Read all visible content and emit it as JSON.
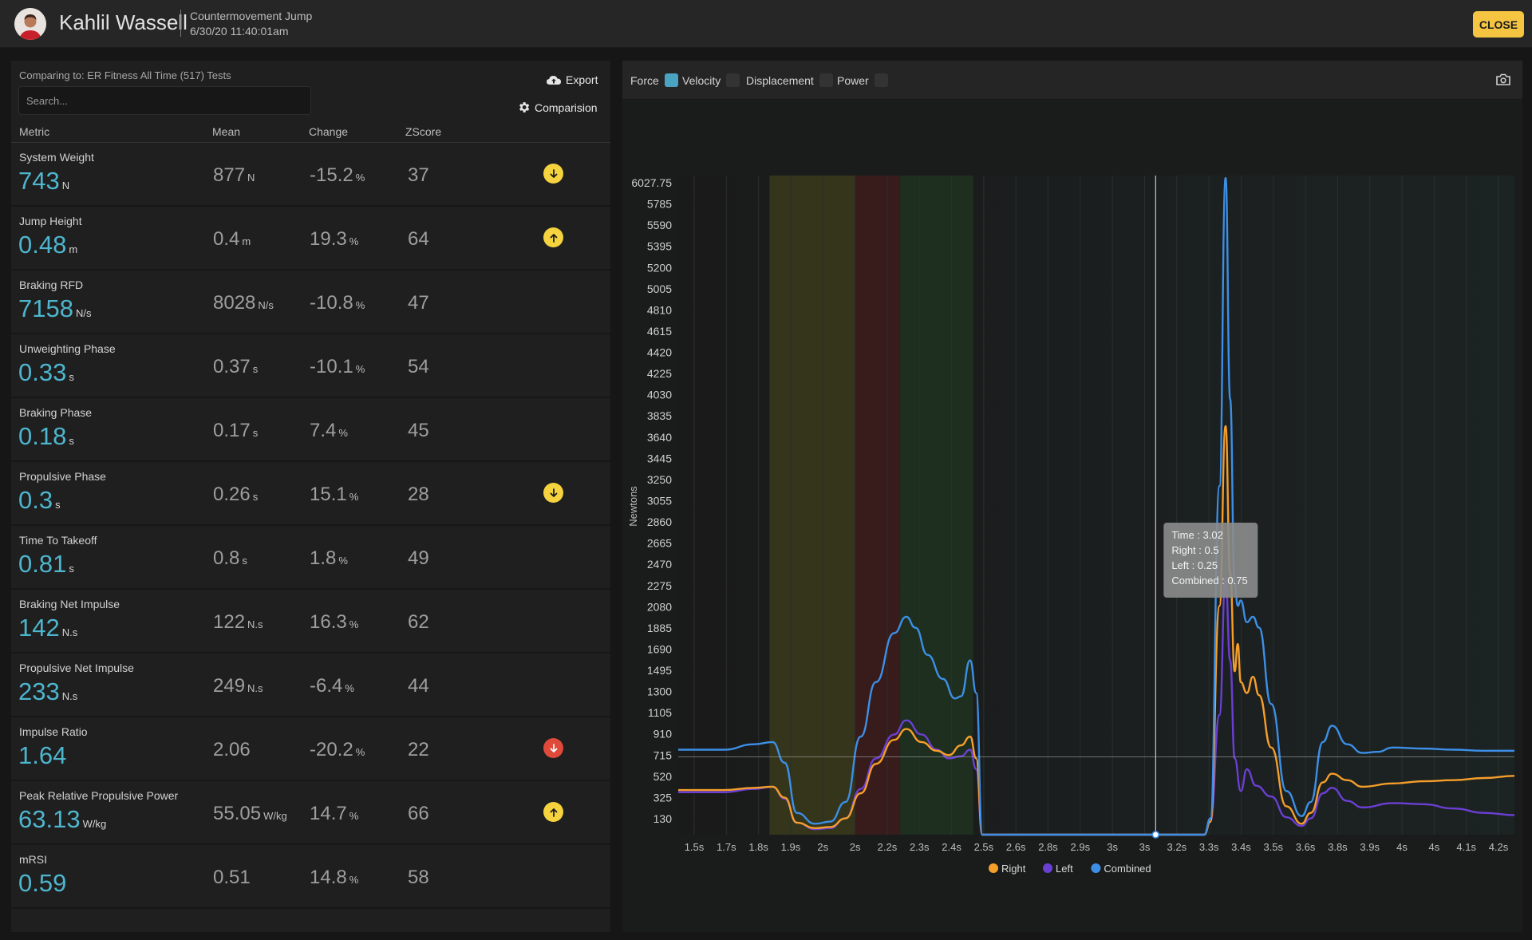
{
  "header": {
    "athlete_name": "Kahlil Wassell",
    "test_name": "Countermovement Jump",
    "test_date": "6/30/20 11:40:01am",
    "close_label": "CLOSE"
  },
  "left": {
    "comparing_text": "Comparing to: ER Fitness All Time (517) Tests",
    "search_placeholder": "Search...",
    "export_label": "Export",
    "comparison_label": "Comparision",
    "columns": [
      "Metric",
      "Mean",
      "Change",
      "ZScore"
    ]
  },
  "metrics": [
    {
      "label": "System Weight",
      "value": "743",
      "unit": "N",
      "mean": "877",
      "mean_unit": "N",
      "change": "-15.2",
      "change_unit": "%",
      "zscore": "37",
      "indicator": "down-yellow"
    },
    {
      "label": "Jump Height",
      "value": "0.48",
      "unit": "m",
      "mean": "0.4",
      "mean_unit": "m",
      "change": "19.3",
      "change_unit": "%",
      "zscore": "64",
      "indicator": "up-yellow"
    },
    {
      "label": "Braking RFD",
      "value": "7158",
      "unit": "N/s",
      "mean": "8028",
      "mean_unit": "N/s",
      "change": "-10.8",
      "change_unit": "%",
      "zscore": "47",
      "indicator": "none"
    },
    {
      "label": "Unweighting Phase",
      "value": "0.33",
      "unit": "s",
      "mean": "0.37",
      "mean_unit": "s",
      "change": "-10.1",
      "change_unit": "%",
      "zscore": "54",
      "indicator": "none"
    },
    {
      "label": "Braking Phase",
      "value": "0.18",
      "unit": "s",
      "mean": "0.17",
      "mean_unit": "s",
      "change": "7.4",
      "change_unit": "%",
      "zscore": "45",
      "indicator": "none"
    },
    {
      "label": "Propulsive Phase",
      "value": "0.3",
      "unit": "s",
      "mean": "0.26",
      "mean_unit": "s",
      "change": "15.1",
      "change_unit": "%",
      "zscore": "28",
      "indicator": "down-yellow"
    },
    {
      "label": "Time To Takeoff",
      "value": "0.81",
      "unit": "s",
      "mean": "0.8",
      "mean_unit": "s",
      "change": "1.8",
      "change_unit": "%",
      "zscore": "49",
      "indicator": "none"
    },
    {
      "label": "Braking Net Impulse",
      "value": "142",
      "unit": "N.s",
      "mean": "122",
      "mean_unit": "N.s",
      "change": "16.3",
      "change_unit": "%",
      "zscore": "62",
      "indicator": "none"
    },
    {
      "label": "Propulsive Net Impulse",
      "value": "233",
      "unit": "N.s",
      "mean": "249",
      "mean_unit": "N.s",
      "change": "-6.4",
      "change_unit": "%",
      "zscore": "44",
      "indicator": "none"
    },
    {
      "label": "Impulse Ratio",
      "value": "1.64",
      "unit": "",
      "mean": "2.06",
      "mean_unit": "",
      "change": "-20.2",
      "change_unit": "%",
      "zscore": "22",
      "indicator": "down-red"
    },
    {
      "label": "Peak Relative Propulsive Power",
      "value": "63.13",
      "unit": "W/kg",
      "mean": "55.05",
      "mean_unit": "W/kg",
      "change": "14.7",
      "change_unit": "%",
      "zscore": "66",
      "indicator": "up-yellow"
    },
    {
      "label": "mRSI",
      "value": "0.59",
      "unit": "",
      "mean": "0.51",
      "mean_unit": "",
      "change": "14.8",
      "change_unit": "%",
      "zscore": "58",
      "indicator": "none"
    }
  ],
  "toggles": [
    {
      "label": "Force",
      "checked": true
    },
    {
      "label": "Velocity",
      "checked": false
    },
    {
      "label": "Displacement",
      "checked": false
    },
    {
      "label": "Power",
      "checked": false
    }
  ],
  "colors": {
    "accent_value": "#4db6ce",
    "indicator_yellow": "#f5d33f",
    "indicator_red": "#e04a3a",
    "right": "#f59e2a",
    "left": "#6b3fd4",
    "combined": "#3d8fe6",
    "unweighting_band": "#3a3a1a",
    "braking_band": "#3e1c1c",
    "propulsive_band": "#1f3320"
  },
  "tooltip": {
    "time": "Time : 3.02",
    "right": "Right : 0.5",
    "left": "Left : 0.25",
    "combined": "Combined : 0.75"
  },
  "chart_data": {
    "type": "line",
    "ylabel": "Newtons",
    "y_ticks": [
      "6027.75",
      "5785",
      "5590",
      "5395",
      "5200",
      "5005",
      "4810",
      "4615",
      "4420",
      "4225",
      "4030",
      "3835",
      "3640",
      "3445",
      "3250",
      "3055",
      "2860",
      "2665",
      "2470",
      "2275",
      "2080",
      "1885",
      "1690",
      "1495",
      "1300",
      "1105",
      "910",
      "715",
      "520",
      "325",
      "130"
    ],
    "x_ticks": [
      "1.5s",
      "1.7s",
      "1.8s",
      "1.9s",
      "2s",
      "2s",
      "2.2s",
      "2.3s",
      "2.4s",
      "2.5s",
      "2.6s",
      "2.8s",
      "2.9s",
      "3s",
      "3s",
      "3.2s",
      "3.3s",
      "3.4s",
      "3.5s",
      "3.6s",
      "3.8s",
      "3.9s",
      "4s",
      "4s",
      "4.1s",
      "4.2s"
    ],
    "xlim": [
      1.45,
      4.2
    ],
    "ylim": [
      0,
      6027.75
    ],
    "phases": [
      {
        "name": "unweighting",
        "start": 1.75,
        "end": 2.03
      },
      {
        "name": "braking",
        "start": 2.03,
        "end": 2.18
      },
      {
        "name": "propulsive",
        "start": 2.18,
        "end": 2.42
      }
    ],
    "crosshair": {
      "x": 3.02,
      "y": 715
    },
    "series": [
      {
        "name": "Right",
        "points": [
          [
            1.45,
            410
          ],
          [
            1.6,
            410
          ],
          [
            1.7,
            430
          ],
          [
            1.76,
            440
          ],
          [
            1.8,
            340
          ],
          [
            1.84,
            110
          ],
          [
            1.9,
            60
          ],
          [
            1.95,
            70
          ],
          [
            2.0,
            150
          ],
          [
            2.05,
            380
          ],
          [
            2.1,
            650
          ],
          [
            2.16,
            870
          ],
          [
            2.2,
            970
          ],
          [
            2.25,
            850
          ],
          [
            2.3,
            770
          ],
          [
            2.34,
            730
          ],
          [
            2.38,
            820
          ],
          [
            2.41,
            900
          ],
          [
            2.43,
            700
          ],
          [
            2.45,
            0
          ],
          [
            2.8,
            0
          ],
          [
            2.9,
            0
          ],
          [
            3.0,
            0
          ],
          [
            3.18,
            0
          ],
          [
            3.2,
            120
          ],
          [
            3.23,
            2100
          ],
          [
            3.25,
            3750
          ],
          [
            3.265,
            2400
          ],
          [
            3.28,
            1500
          ],
          [
            3.29,
            1750
          ],
          [
            3.3,
            1400
          ],
          [
            3.32,
            1300
          ],
          [
            3.34,
            1450
          ],
          [
            3.36,
            1280
          ],
          [
            3.4,
            800
          ],
          [
            3.45,
            260
          ],
          [
            3.5,
            100
          ],
          [
            3.53,
            200
          ],
          [
            3.57,
            480
          ],
          [
            3.6,
            560
          ],
          [
            3.65,
            500
          ],
          [
            3.7,
            440
          ],
          [
            3.8,
            470
          ],
          [
            3.9,
            490
          ],
          [
            4.0,
            500
          ],
          [
            4.1,
            520
          ],
          [
            4.2,
            540
          ]
        ]
      },
      {
        "name": "Left",
        "points": [
          [
            1.45,
            390
          ],
          [
            1.6,
            390
          ],
          [
            1.7,
            420
          ],
          [
            1.76,
            440
          ],
          [
            1.8,
            330
          ],
          [
            1.84,
            110
          ],
          [
            1.9,
            50
          ],
          [
            1.95,
            60
          ],
          [
            2.0,
            150
          ],
          [
            2.05,
            420
          ],
          [
            2.1,
            700
          ],
          [
            2.16,
            920
          ],
          [
            2.2,
            1050
          ],
          [
            2.25,
            920
          ],
          [
            2.3,
            780
          ],
          [
            2.34,
            700
          ],
          [
            2.38,
            720
          ],
          [
            2.41,
            780
          ],
          [
            2.43,
            600
          ],
          [
            2.45,
            0
          ],
          [
            2.8,
            0
          ],
          [
            2.9,
            0
          ],
          [
            3.0,
            0
          ],
          [
            3.18,
            0
          ],
          [
            3.2,
            120
          ],
          [
            3.23,
            1100
          ],
          [
            3.25,
            2350
          ],
          [
            3.265,
            1600
          ],
          [
            3.28,
            700
          ],
          [
            3.3,
            400
          ],
          [
            3.32,
            600
          ],
          [
            3.35,
            450
          ],
          [
            3.4,
            350
          ],
          [
            3.45,
            160
          ],
          [
            3.5,
            80
          ],
          [
            3.53,
            150
          ],
          [
            3.57,
            380
          ],
          [
            3.6,
            430
          ],
          [
            3.65,
            310
          ],
          [
            3.7,
            250
          ],
          [
            3.8,
            290
          ],
          [
            3.9,
            280
          ],
          [
            4.0,
            240
          ],
          [
            4.1,
            200
          ],
          [
            4.2,
            180
          ]
        ]
      },
      {
        "name": "Combined",
        "points": [
          [
            1.45,
            780
          ],
          [
            1.6,
            780
          ],
          [
            1.7,
            830
          ],
          [
            1.76,
            850
          ],
          [
            1.8,
            660
          ],
          [
            1.84,
            200
          ],
          [
            1.9,
            100
          ],
          [
            1.95,
            120
          ],
          [
            2.0,
            300
          ],
          [
            2.05,
            900
          ],
          [
            2.1,
            1400
          ],
          [
            2.16,
            1850
          ],
          [
            2.2,
            2000
          ],
          [
            2.23,
            1900
          ],
          [
            2.27,
            1650
          ],
          [
            2.32,
            1430
          ],
          [
            2.36,
            1250
          ],
          [
            2.38,
            1270
          ],
          [
            2.41,
            1600
          ],
          [
            2.43,
            1300
          ],
          [
            2.45,
            0
          ],
          [
            2.8,
            0
          ],
          [
            2.9,
            0
          ],
          [
            3.0,
            0
          ],
          [
            3.18,
            0
          ],
          [
            3.2,
            150
          ],
          [
            3.23,
            3200
          ],
          [
            3.25,
            6027
          ],
          [
            3.265,
            4000
          ],
          [
            3.28,
            2300
          ],
          [
            3.29,
            2100
          ],
          [
            3.3,
            2150
          ],
          [
            3.32,
            1950
          ],
          [
            3.34,
            2000
          ],
          [
            3.36,
            1900
          ],
          [
            3.4,
            1200
          ],
          [
            3.45,
            400
          ],
          [
            3.5,
            170
          ],
          [
            3.53,
            300
          ],
          [
            3.57,
            850
          ],
          [
            3.6,
            1000
          ],
          [
            3.65,
            830
          ],
          [
            3.7,
            750
          ],
          [
            3.75,
            760
          ],
          [
            3.8,
            800
          ],
          [
            3.9,
            790
          ],
          [
            4.0,
            780
          ],
          [
            4.1,
            770
          ],
          [
            4.2,
            770
          ]
        ]
      }
    ],
    "legend": [
      "Right",
      "Left",
      "Combined"
    ],
    "legend_position": "bottom"
  }
}
